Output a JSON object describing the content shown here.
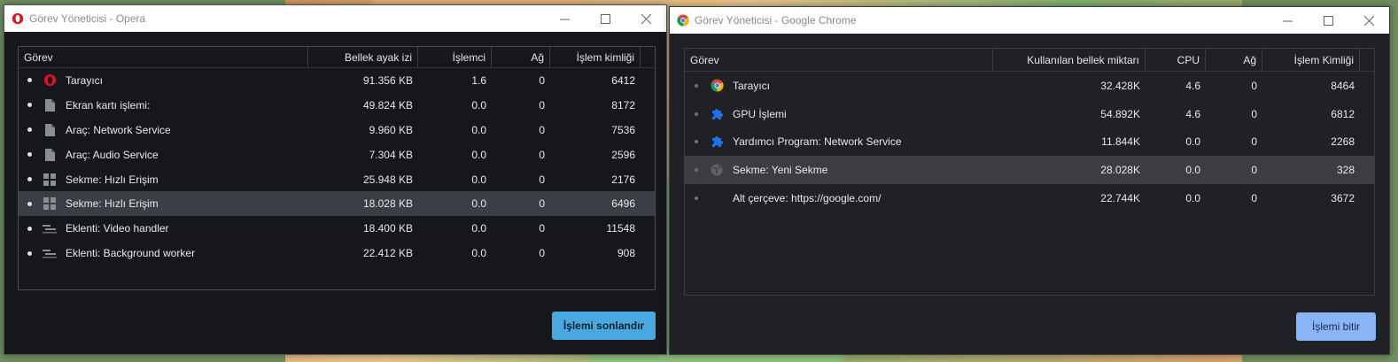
{
  "opera": {
    "title": "Görev Yöneticisi - Opera",
    "columns": [
      "Görev",
      "Bellek ayak izi",
      "İşlemci",
      "Ağ",
      "İşlem kimliği"
    ],
    "rows": [
      {
        "task": "Tarayıcı",
        "memory": "91.356 KB",
        "cpu": "1.6",
        "net": "0",
        "pid": "6412",
        "icon": "opera-logo-icon"
      },
      {
        "task": "Ekran kartı işlemi:",
        "memory": "49.824 KB",
        "cpu": "0.0",
        "net": "0",
        "pid": "8172",
        "icon": "document-icon"
      },
      {
        "task": "Araç: Network Service",
        "memory": "9.960 KB",
        "cpu": "0.0",
        "net": "0",
        "pid": "7536",
        "icon": "document-icon"
      },
      {
        "task": "Araç: Audio Service",
        "memory": "7.304 KB",
        "cpu": "0.0",
        "net": "0",
        "pid": "2596",
        "icon": "document-icon"
      },
      {
        "task": "Sekme: Hızlı Erişim",
        "memory": "25.948 KB",
        "cpu": "0.0",
        "net": "0",
        "pid": "2176",
        "icon": "grid-icon"
      },
      {
        "task": "Sekme: Hızlı Erişim",
        "memory": "18.028 KB",
        "cpu": "0.0",
        "net": "0",
        "pid": "6496",
        "icon": "grid-icon",
        "selected": true
      },
      {
        "task": "Eklenti: Video handler",
        "memory": "18.400 KB",
        "cpu": "0.0",
        "net": "0",
        "pid": "11548",
        "icon": "extension-icon"
      },
      {
        "task": "Eklenti: Background worker",
        "memory": "22.412 KB",
        "cpu": "0.0",
        "net": "0",
        "pid": "908",
        "icon": "extension-icon"
      }
    ],
    "end_button": "İşlemi sonlandır",
    "accent": "#4aa8e0"
  },
  "chrome": {
    "title": "Görev Yöneticisi - Google Chrome",
    "columns": [
      "Görev",
      "Kullanılan bellek miktarı",
      "CPU",
      "Ağ",
      "İşlem Kimliği"
    ],
    "rows": [
      {
        "task": "Tarayıcı",
        "memory": "32.428K",
        "cpu": "4.6",
        "net": "0",
        "pid": "8464",
        "icon": "chrome-logo-icon"
      },
      {
        "task": "GPU İşlemi",
        "memory": "54.892K",
        "cpu": "4.6",
        "net": "0",
        "pid": "6812",
        "icon": "puzzle-icon"
      },
      {
        "task": "Yardımcı Program: Network Service",
        "memory": "11.844K",
        "cpu": "0.0",
        "net": "0",
        "pid": "2268",
        "icon": "puzzle-icon"
      },
      {
        "task": "Sekme: Yeni Sekme",
        "memory": "28.028K",
        "cpu": "0.0",
        "net": "0",
        "pid": "328",
        "icon": "globe-icon",
        "selected": true
      },
      {
        "task": "Alt çerçeve: https://google.com/",
        "memory": "22.744K",
        "cpu": "0.0",
        "net": "0",
        "pid": "3672",
        "icon": "none"
      }
    ],
    "end_button": "İşlemi bitir",
    "accent": "#8ab4f8"
  }
}
